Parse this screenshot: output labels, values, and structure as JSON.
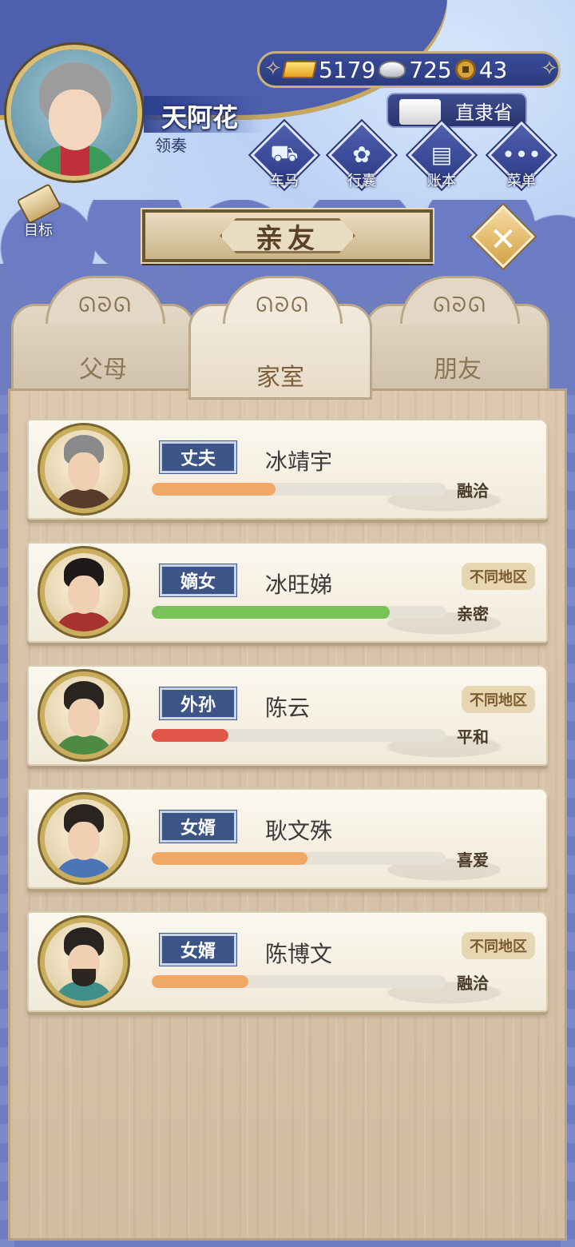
{
  "player": {
    "name": "天阿花",
    "title": "领奏"
  },
  "currency": {
    "gold": "5179",
    "silver": "725",
    "coins": "43"
  },
  "province": "直隶省",
  "nav": [
    {
      "label": "车马",
      "icon": "carriage-icon"
    },
    {
      "label": "行囊",
      "icon": "bundle-icon"
    },
    {
      "label": "账本",
      "icon": "ledger-icon"
    },
    {
      "label": "菜单",
      "icon": "menu-dots-icon"
    }
  ],
  "goal_label": "目标",
  "page_title": "亲友",
  "tabs": [
    {
      "label": "父母",
      "active": false
    },
    {
      "label": "家室",
      "active": true
    },
    {
      "label": "朋友",
      "active": false
    }
  ],
  "relatives": [
    {
      "role": "丈夫",
      "name": "冰靖宇",
      "status": "融洽",
      "region": "",
      "affinity": 0.42,
      "bar_color": "#f0a867"
    },
    {
      "role": "嫡女",
      "name": "冰旺娣",
      "status": "亲密",
      "region": "不同地区",
      "affinity": 0.81,
      "bar_color": "#78c257"
    },
    {
      "role": "外孙",
      "name": "陈云",
      "status": "平和",
      "region": "不同地区",
      "affinity": 0.26,
      "bar_color": "#e0574a"
    },
    {
      "role": "女婿",
      "name": "耿文殊",
      "status": "喜爱",
      "region": "",
      "affinity": 0.53,
      "bar_color": "#f0a867"
    },
    {
      "role": "女婿",
      "name": "陈博文",
      "status": "融洽",
      "region": "不同地区",
      "affinity": 0.33,
      "bar_color": "#f0a867"
    }
  ]
}
